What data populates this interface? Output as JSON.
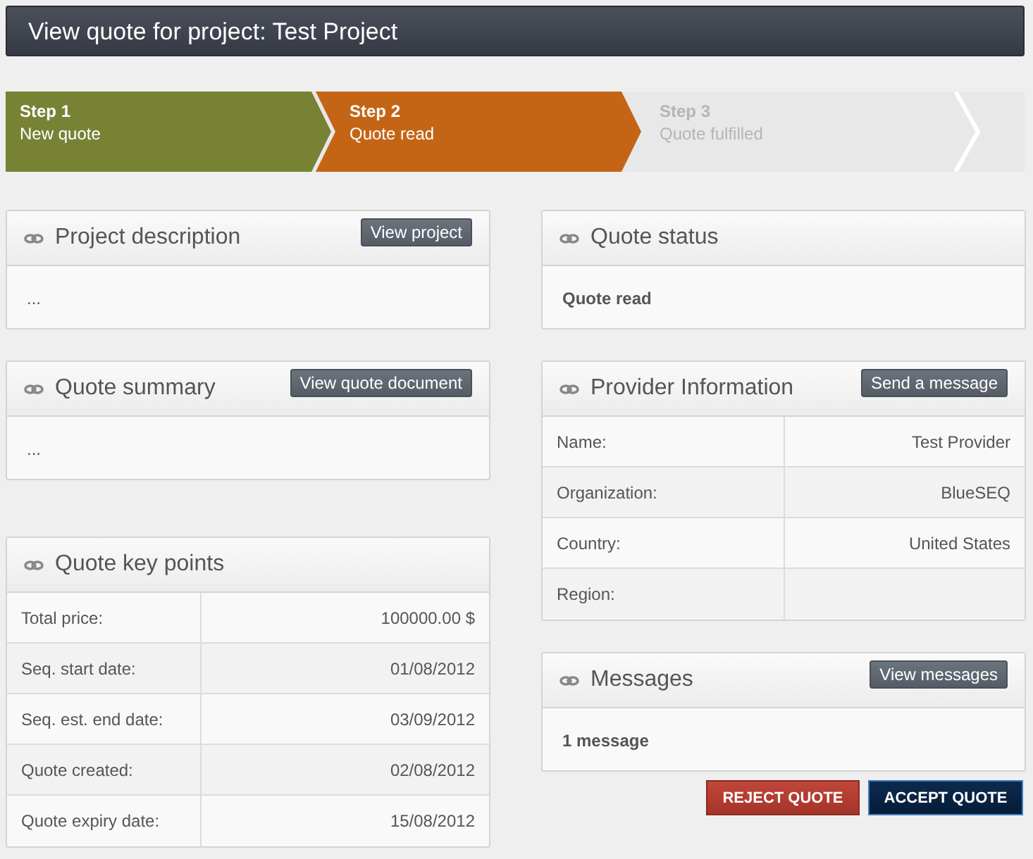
{
  "header": {
    "title": "View quote for project: Test Project"
  },
  "steps": [
    {
      "label": "Step 1",
      "caption": "New quote",
      "completed": true,
      "selected": false
    },
    {
      "label": "Step 2",
      "caption": "Quote read",
      "completed": false,
      "selected": true
    },
    {
      "label": "Step 3",
      "caption": "Quote fulfilled",
      "completed": false,
      "selected": false
    }
  ],
  "left_panels": [
    {
      "title": "Project description",
      "button": "View project",
      "kind": "text",
      "text": "..."
    },
    {
      "title": "Quote summary",
      "button": "View quote document",
      "kind": "text",
      "text": "..."
    },
    {
      "title": "Quote key points",
      "kind": "table",
      "rows": [
        {
          "label": "Total price:",
          "value": "100000.00 $"
        },
        {
          "label": "Seq. start date:",
          "value": "01/08/2012"
        },
        {
          "label": "Seq. est. end date:",
          "value": "03/09/2012"
        },
        {
          "label": "Quote created:",
          "value": "02/08/2012"
        },
        {
          "label": "Quote expiry date:",
          "value": "15/08/2012"
        }
      ]
    }
  ],
  "right_panels": [
    {
      "title": "Quote status",
      "kind": "bold_text",
      "text": "Quote read"
    },
    {
      "title": "Provider Information",
      "button": "Send a message",
      "kind": "table",
      "rows": [
        {
          "label": "Name:",
          "value": "Test Provider"
        },
        {
          "label": "Organization:",
          "value": "BlueSEQ"
        },
        {
          "label": "Country:",
          "value": "United States"
        },
        {
          "label": "Region:"
        }
      ]
    },
    {
      "title": "Messages",
      "button": "View messages",
      "kind": "bold_text",
      "text": "1 message"
    }
  ],
  "actions": [
    {
      "label": "REJECT QUOTE",
      "kind": "reject"
    },
    {
      "label": "ACCEPT QUOTE",
      "kind": "accept"
    }
  ]
}
